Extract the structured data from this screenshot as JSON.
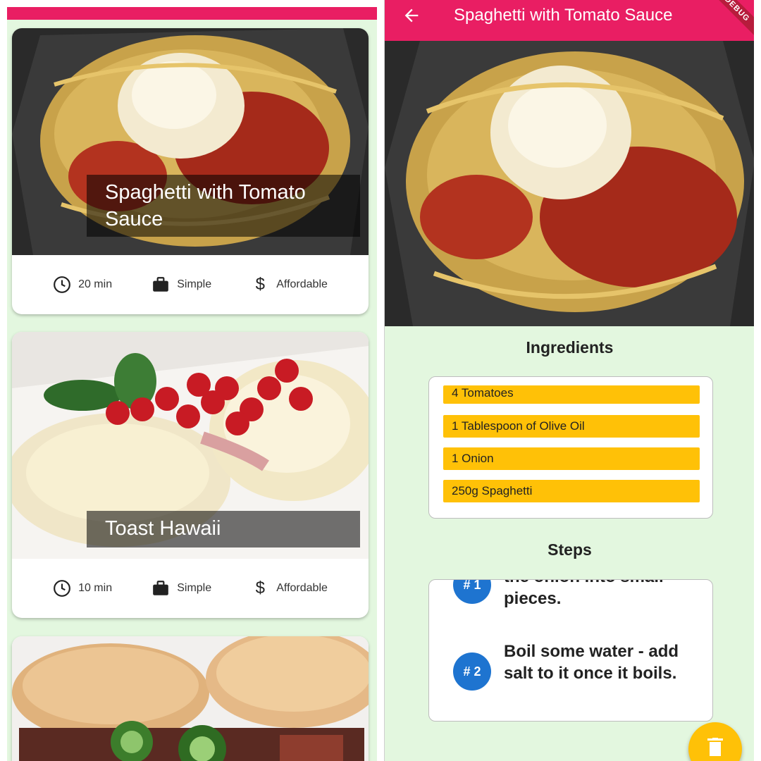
{
  "left_list": {
    "meals": [
      {
        "title": "Spaghetti with Tomato Sauce",
        "duration": "20 min",
        "complexity": "Simple",
        "affordability": "Affordable"
      },
      {
        "title": "Toast Hawaii",
        "duration": "10 min",
        "complexity": "Simple",
        "affordability": "Affordable"
      }
    ]
  },
  "detail": {
    "title": "Spaghetti with Tomato Sauce",
    "debug_banner": "DEBUG",
    "ingredients_heading": "Ingredients",
    "ingredients": [
      "4 Tomatoes",
      "1 Tablespoon of Olive Oil",
      "1 Onion",
      "250g Spaghetti"
    ],
    "steps_heading": "Steps",
    "steps": [
      {
        "badge": "# 1",
        "text_line1": "the onion into small",
        "text_line2": "pieces."
      },
      {
        "badge": "# 2",
        "text": "Boil some water - add salt to it once it boils."
      }
    ]
  },
  "icons": {
    "duration": "clock-icon",
    "complexity": "work-icon",
    "affordability": "dollar-icon",
    "back": "arrow-back-icon",
    "delete": "delete-icon"
  },
  "colors": {
    "app_bar": "#e91e63",
    "background": "#e3f7df",
    "ingredient": "#ffc107",
    "step_badge": "#1e74d0",
    "fab": "#ffc107"
  }
}
